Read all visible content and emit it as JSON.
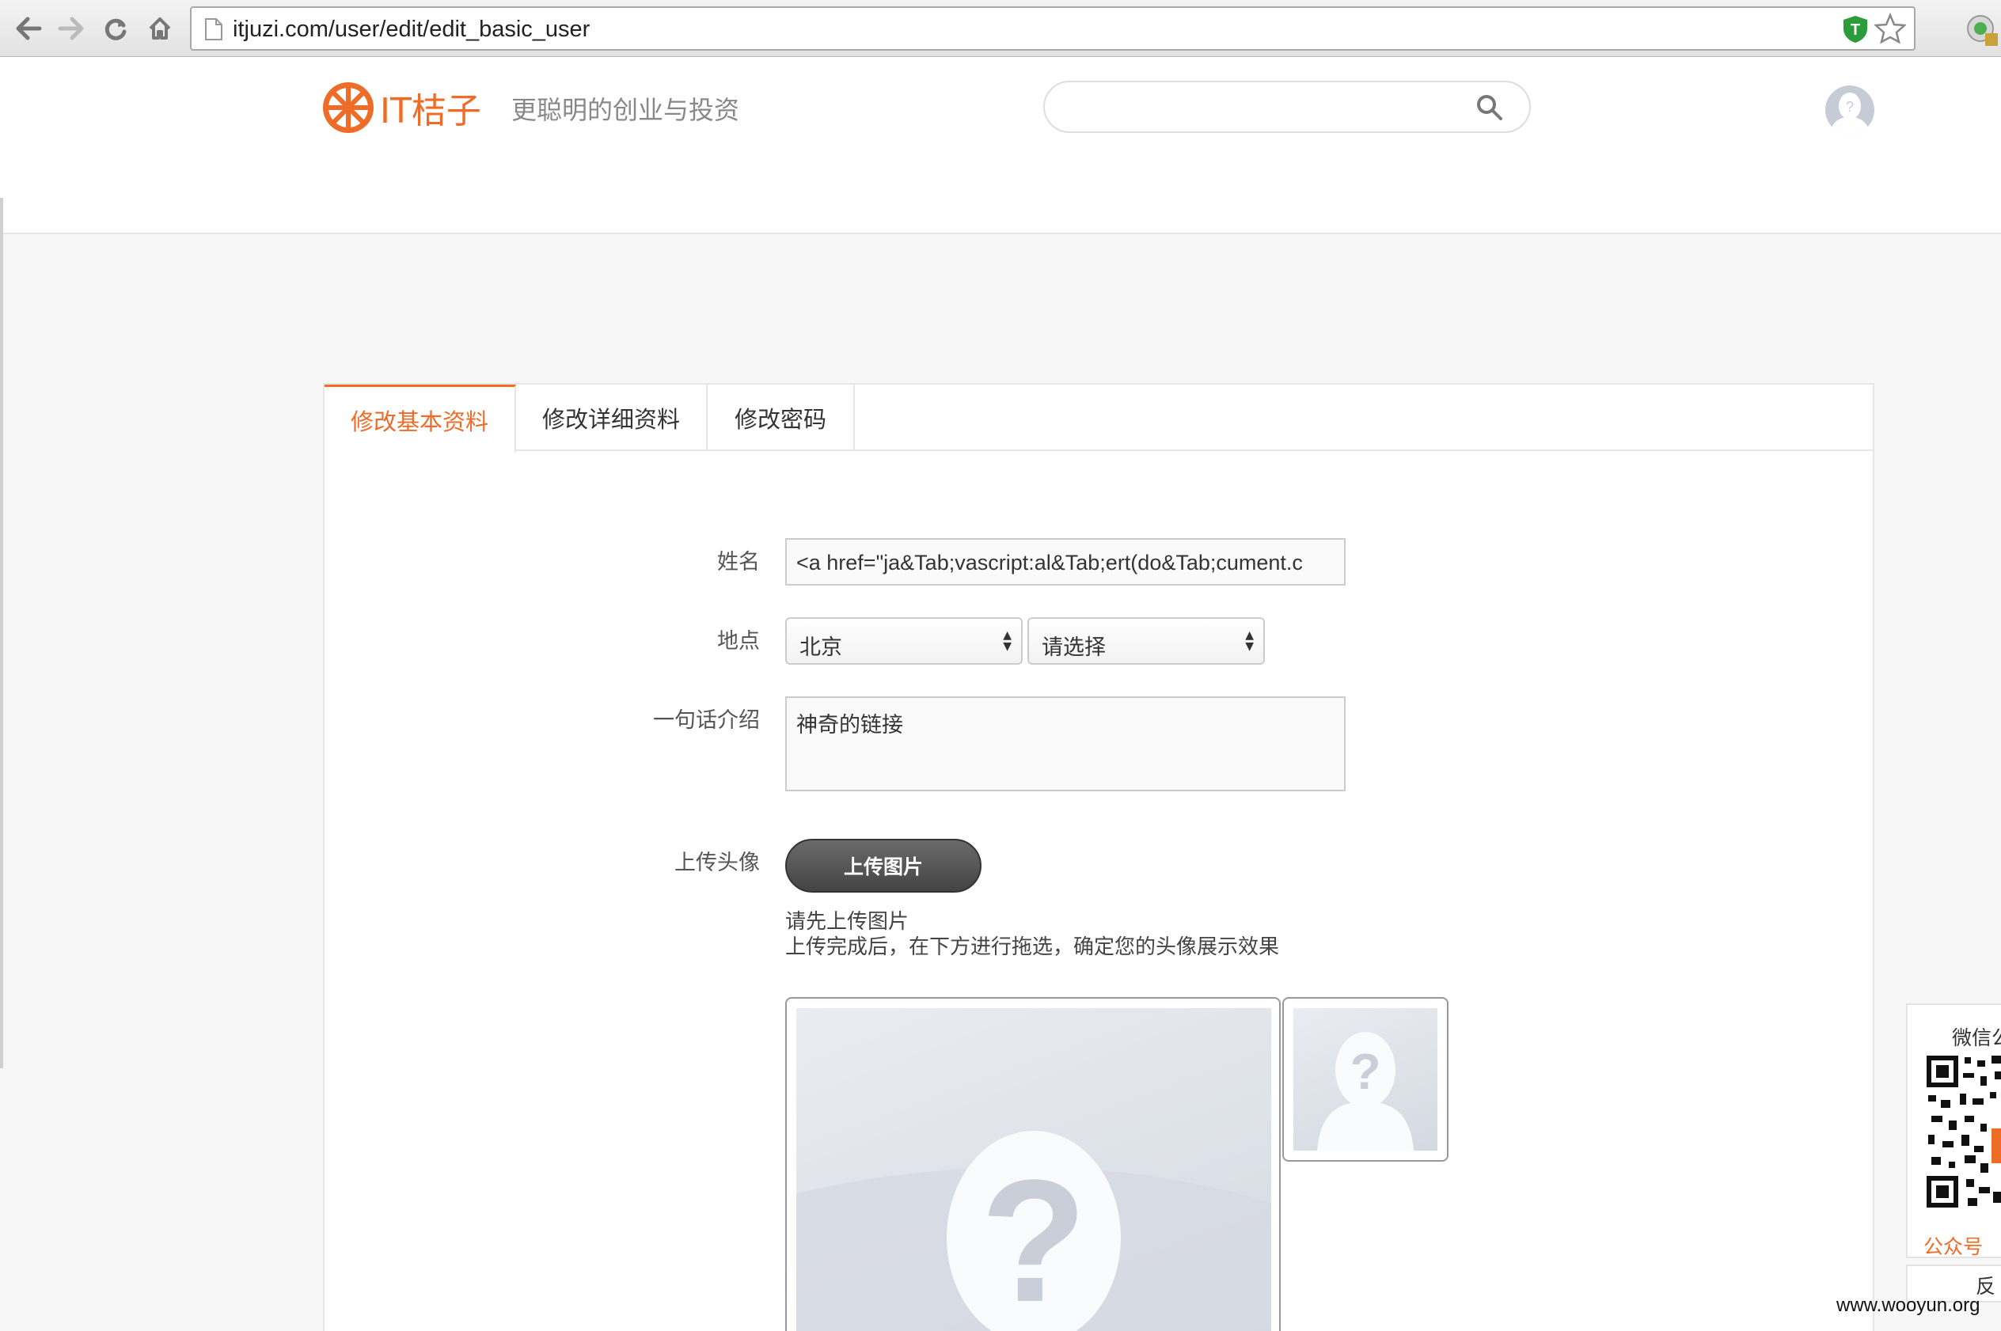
{
  "browser": {
    "url": "itjuzi.com/user/edit/edit_basic_user"
  },
  "header": {
    "logo_text": "IT桔子",
    "slogan": "更聪明的创业与投资",
    "search_placeholder": ""
  },
  "tabs": [
    {
      "label": "修改基本资料",
      "active": true
    },
    {
      "label": "修改详细资料",
      "active": false
    },
    {
      "label": "修改密码",
      "active": false
    }
  ],
  "form": {
    "name_label": "姓名",
    "name_value": "<a href=\"ja&Tab;vascript:al&Tab;ert(do&Tab;cument.c",
    "location_label": "地点",
    "province_value": "北京",
    "city_value": "请选择",
    "intro_label": "一句话介绍",
    "intro_value": "神奇的链接",
    "avatar_label": "上传头像",
    "upload_button": "上传图片",
    "hint_line1": "请先上传图片",
    "hint_line2": "上传完成后，在下方进行拖选，确定您的头像展示效果"
  },
  "side": {
    "wechat_title": "微信公",
    "wechat_subtitle": "公众号",
    "feedback": "反"
  },
  "watermark": "www.wooyun.org",
  "colors": {
    "accent": "#ef6b28",
    "border": "#e6e6e6"
  }
}
